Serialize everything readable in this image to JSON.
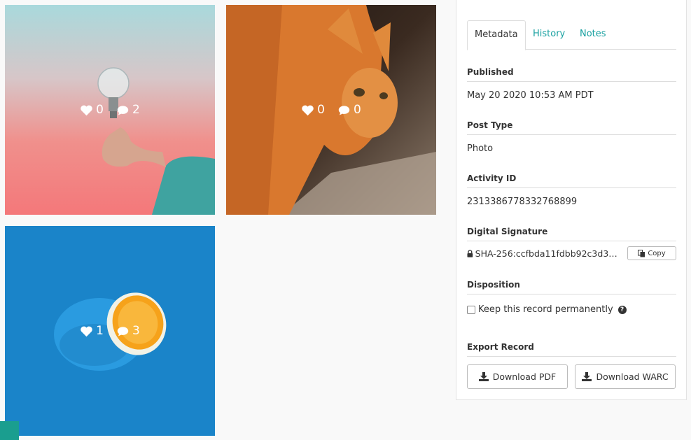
{
  "photos": [
    {
      "name": "lightbulb",
      "likes": "0",
      "comments": "2"
    },
    {
      "name": "cat",
      "likes": "0",
      "comments": "0"
    },
    {
      "name": "orange",
      "likes": "1",
      "comments": "3"
    }
  ],
  "icons": {
    "like": "heart-icon",
    "comment": "speech-bubble-icon",
    "lock": "lock-icon",
    "copy": "copy-icon",
    "download": "download-icon",
    "help": "question-circle-icon"
  },
  "colors": {
    "accent": "#17a0a0",
    "corner": "#1a9e8f"
  },
  "tabs": [
    {
      "label": "Metadata",
      "active": true
    },
    {
      "label": "History",
      "active": false
    },
    {
      "label": "Notes",
      "active": false
    }
  ],
  "metadata": {
    "published_label": "Published",
    "published_value": "May 20 2020 10:53 AM PDT",
    "post_type_label": "Post Type",
    "post_type_value": "Photo",
    "activity_id_label": "Activity ID",
    "activity_id_value": "2313386778332768899",
    "signature_label": "Digital Signature",
    "signature_value": "SHA-256:ccfbda11fdbb92c3d34d...",
    "copy_label": "Copy",
    "disposition_label": "Disposition",
    "keep_label": "Keep this record permanently",
    "keep_checked": false,
    "export_label": "Export Record",
    "download_pdf_label": "Download PDF",
    "download_warc_label": "Download WARC"
  }
}
